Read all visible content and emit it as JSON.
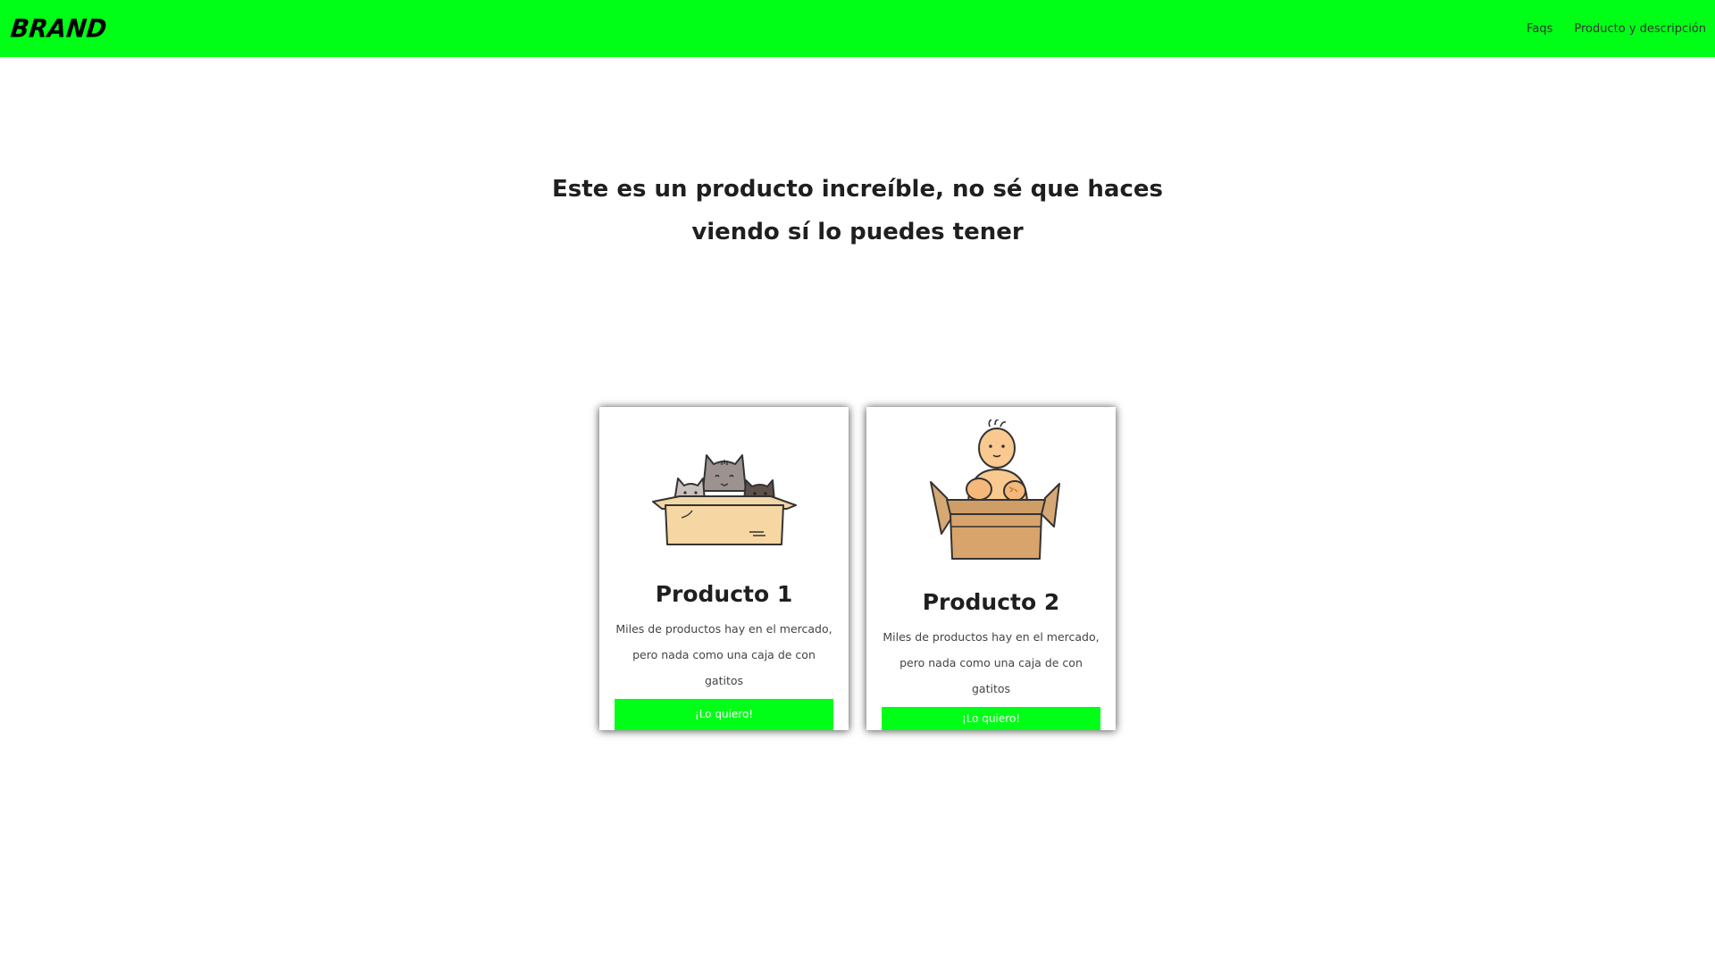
{
  "navbar": {
    "brand": "BRAND",
    "links": [
      "Faqs",
      "Producto y descripción"
    ],
    "background": "#00ff17"
  },
  "hero": {
    "title_line1": "Este es un producto increíble, no sé que haces",
    "title_line2": "viendo sí lo puedes tener"
  },
  "products": [
    {
      "title": "Producto 1",
      "description_line1": "Miles de productos hay en el mercado,",
      "description_line2": "pero nada como una caja de con gatitos",
      "button": "¡Lo quiero!",
      "image": "cats-in-box-illustration"
    },
    {
      "title": "Producto 2",
      "description_line1": "Miles de productos hay en el mercado,",
      "description_line2": "pero nada como una caja de con gatitos",
      "button": "¡Lo quiero!",
      "image": "baby-in-box-illustration"
    }
  ],
  "colors": {
    "accent": "#00ff17",
    "text": "#1f1f1f"
  }
}
